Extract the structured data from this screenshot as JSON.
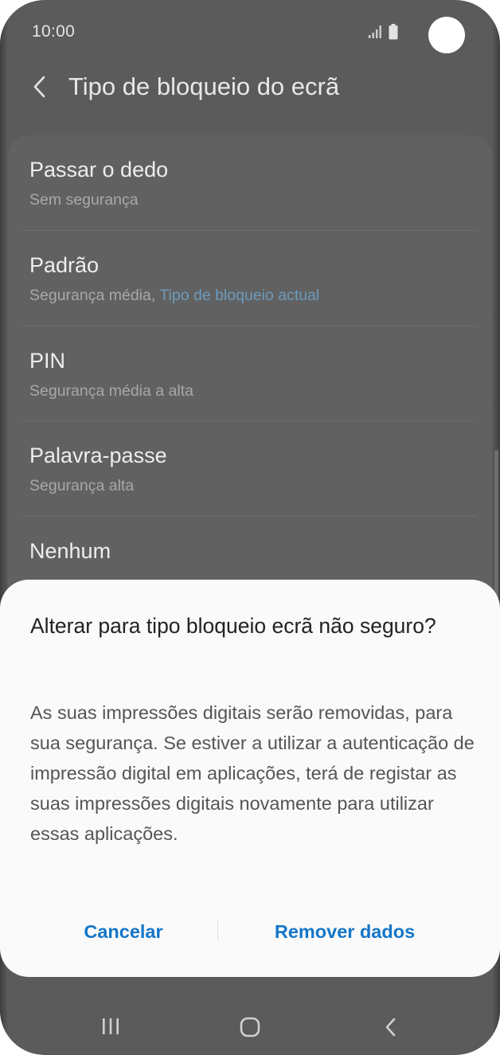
{
  "status_bar": {
    "time": "10:00"
  },
  "header": {
    "title": "Tipo de bloqueio do ecrã"
  },
  "lock_types": [
    {
      "title": "Passar o dedo",
      "subtitle": "Sem segurança",
      "subtitle_highlight": ""
    },
    {
      "title": "Padrão",
      "subtitle": "Segurança média, ",
      "subtitle_highlight": "Tipo de bloqueio actual"
    },
    {
      "title": "PIN",
      "subtitle": "Segurança média a alta",
      "subtitle_highlight": ""
    },
    {
      "title": "Palavra-passe",
      "subtitle": "Segurança alta",
      "subtitle_highlight": ""
    },
    {
      "title": "Nenhum",
      "subtitle": "",
      "subtitle_highlight": ""
    }
  ],
  "dialog": {
    "title": "Alterar para tipo bloqueio ecrã não seguro?",
    "body": "As suas impressões digitais serão removidas, para sua segurança. Se estiver a utilizar a autenticação de impressão digital em aplicações, terá de registar as suas impressões digitais novamente para utilizar essas aplicações.",
    "cancel_label": "Cancelar",
    "remove_label": "Remover dados"
  },
  "icons": {
    "back": "chevron-left-icon",
    "signal": "signal-icon",
    "battery": "battery-icon",
    "nav_recents": "recents-icon",
    "nav_home": "home-icon",
    "nav_back": "nav-back-icon"
  },
  "colors": {
    "accent": "#1476c8",
    "current_lock_highlight": "#6d9bbd",
    "dimmed_background": "#5b5b5b",
    "dialog_background": "#fafafa"
  }
}
